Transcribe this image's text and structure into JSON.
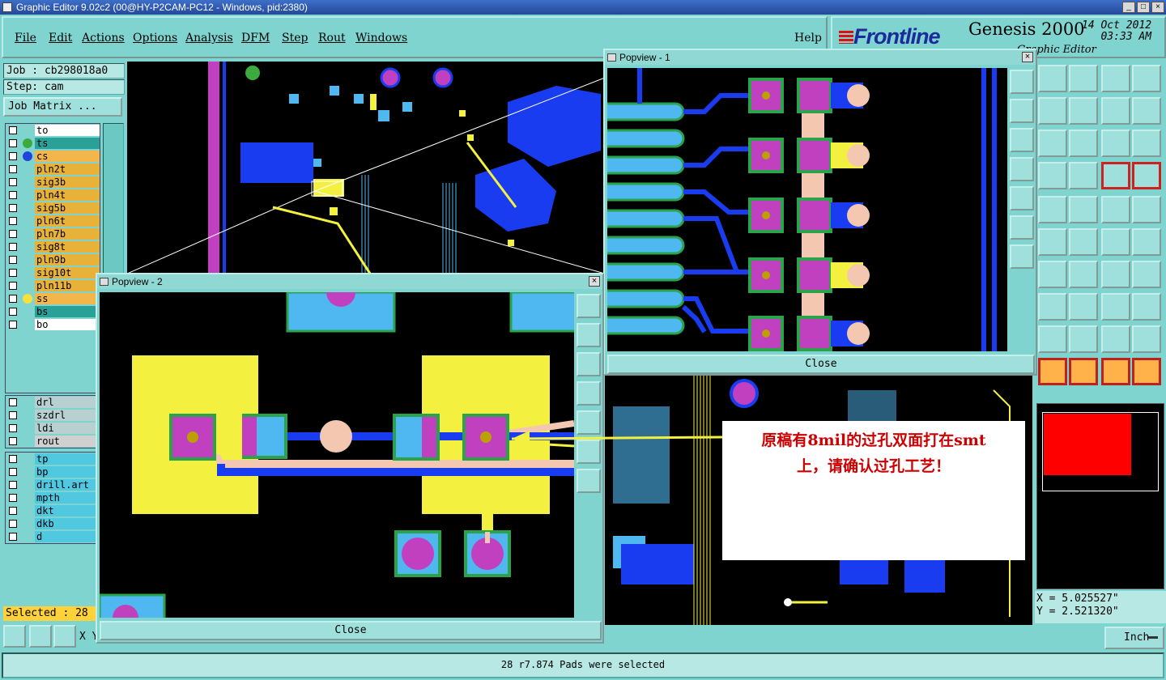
{
  "window": {
    "title": "Graphic Editor 9.02c2 (00@HY-P2CAM-PC12 - Windows, pid:2380)",
    "btn_min": "_",
    "btn_max": "□",
    "btn_close": "×"
  },
  "menu": [
    "File",
    "Edit",
    "Actions",
    "Options",
    "Analysis",
    "DFM",
    "Step",
    "Rout",
    "Windows"
  ],
  "help": "Help",
  "brand": {
    "logo": "Frontline",
    "product": "Genesis 2000",
    "date": "14 Oct 2012",
    "time": "03:33 AM",
    "subtitle": "Graphic Editor"
  },
  "job": {
    "job": "Job : cb298018a0",
    "step": "Step: cam",
    "matrix_btn": "Job Matrix ..."
  },
  "layers_board": [
    {
      "name": "to",
      "color": "#ffffff",
      "dot": ""
    },
    {
      "name": "ts",
      "color": "#2aa198",
      "dot": "#3caa3c"
    },
    {
      "name": "cs",
      "color": "#f2b64a",
      "dot": "#2244dd"
    },
    {
      "name": "pln2t",
      "color": "#e8b23a",
      "dot": ""
    },
    {
      "name": "sig3b",
      "color": "#e8b23a",
      "dot": ""
    },
    {
      "name": "pln4t",
      "color": "#e8b23a",
      "dot": ""
    },
    {
      "name": "sig5b",
      "color": "#e8b23a",
      "dot": ""
    },
    {
      "name": "pln6t",
      "color": "#e8b23a",
      "dot": ""
    },
    {
      "name": "pln7b",
      "color": "#e8b23a",
      "dot": ""
    },
    {
      "name": "sig8t",
      "color": "#e8b23a",
      "dot": ""
    },
    {
      "name": "pln9b",
      "color": "#e8b23a",
      "dot": ""
    },
    {
      "name": "sig10t",
      "color": "#e8b23a",
      "dot": ""
    },
    {
      "name": "pln11b",
      "color": "#e8b23a",
      "dot": ""
    },
    {
      "name": "ss",
      "color": "#f2b64a",
      "dot": "#f4e23a"
    },
    {
      "name": "bs",
      "color": "#2aa198",
      "dot": ""
    },
    {
      "name": "bo",
      "color": "#ffffff",
      "dot": ""
    }
  ],
  "layers_drill": [
    {
      "name": "drl",
      "color": "#b8d0d0"
    },
    {
      "name": "szdrl",
      "color": "#b8d0d0"
    },
    {
      "name": "ldi",
      "color": "#b8d0d0"
    },
    {
      "name": "rout",
      "color": "#d0d0d0"
    }
  ],
  "layers_misc": [
    {
      "name": "tp",
      "color": "#4fc8e0"
    },
    {
      "name": "bp",
      "color": "#4fc8e0"
    },
    {
      "name": "drill.art",
      "color": "#4fc8e0"
    },
    {
      "name": "mpth",
      "color": "#4fc8e0"
    },
    {
      "name": "dkt",
      "color": "#4fc8e0"
    },
    {
      "name": "dkb",
      "color": "#4fc8e0"
    },
    {
      "name": "d",
      "color": "#4fc8e0"
    }
  ],
  "selected": "Selected : 28",
  "xy_label": "X Y",
  "popview1": {
    "title": "Popview - 1",
    "close": "Close"
  },
  "popview2": {
    "title": "Popview - 2",
    "close": "Close"
  },
  "annotation": {
    "line1": "原稿有8mil的过孔双面打在smt",
    "line2": "上，请确认过孔工艺！"
  },
  "coords": {
    "x": "X = 5.025527\"",
    "y": "Y = 2.521320\""
  },
  "units": "Inch",
  "status": "28 r7.874 Pads were selected",
  "colors": {
    "background": "#7fd4d0",
    "pad_purple": "#c040c0",
    "copper_blue": "#1a3cf0",
    "silk_yellow": "#f4f040",
    "mask_cyan": "#4fb8f0"
  }
}
